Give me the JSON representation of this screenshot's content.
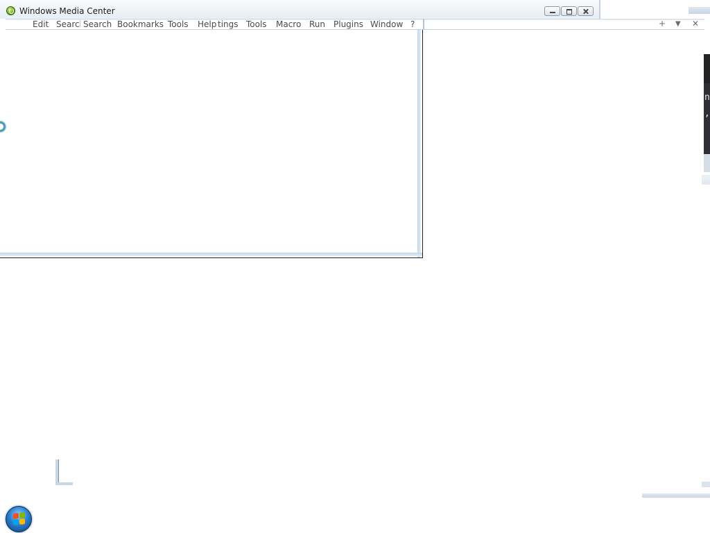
{
  "window": {
    "title": "Windows Media Center",
    "icon": "media-center-logo-icon"
  },
  "caption_buttons": {
    "minimize": "minimize-icon",
    "restore": "restore-icon",
    "close": "close-icon"
  },
  "menubar": {
    "items": [
      {
        "label": "Edit"
      },
      {
        "label": "Search"
      },
      {
        "label": "Search"
      },
      {
        "label": "Bookmarks"
      },
      {
        "label": "Tools"
      },
      {
        "label": "Help"
      },
      {
        "label": "tings"
      },
      {
        "label": "Tools"
      },
      {
        "label": "Macro"
      },
      {
        "label": "Run"
      },
      {
        "label": "Plugins"
      },
      {
        "label": "Window"
      },
      {
        "label": "?"
      }
    ],
    "right_controls": {
      "add": "+",
      "dropdown": "▼",
      "close": "✕"
    }
  },
  "fragment_text": {
    "char1": "n",
    "char2": ","
  },
  "taskbar": {
    "start_button": "windows-start-orb-icon"
  },
  "colors": {
    "titlebar_bg": "#eef3f8",
    "panel_border": "#c2d6e8",
    "menu_text": "#4a4a4a",
    "start_orb": "#2c7fd0"
  }
}
